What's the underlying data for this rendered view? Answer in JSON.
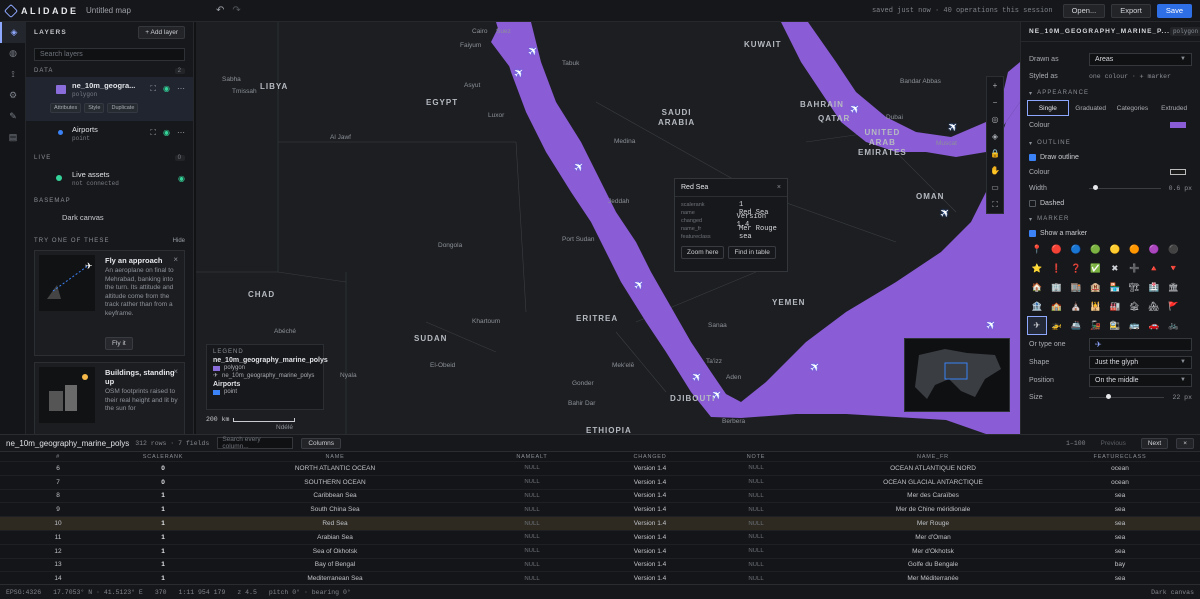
{
  "app": {
    "name": "ALIDADE",
    "map_title": "Untitled map",
    "status": "saved just now · 40 operations this session",
    "open_label": "Open...",
    "export_label": "Export",
    "save_label": "Save"
  },
  "layers_panel": {
    "title": "LAYERS",
    "add_label": "+ Add layer",
    "search_placeholder": "Search layers",
    "data_section": "DATA",
    "data_count": "2",
    "layers": [
      {
        "name": "ne_10m_geogra...",
        "type": "polygon",
        "chips": [
          "Attributes",
          "Style",
          "Duplicate"
        ]
      },
      {
        "name": "Airports",
        "type": "point"
      }
    ],
    "live_section": "LIVE",
    "live_count": "0",
    "live": {
      "name": "Live assets",
      "status": "not connected"
    },
    "basemap_section": "BASEMAP",
    "basemap": "Dark canvas",
    "try_title": "TRY ONE OF THESE",
    "hide_label": "Hide",
    "cards": [
      {
        "title": "Fly an approach",
        "text": "An aeroplane on final to Mehrabad, banking into the turn. Its attitude and altitude come from the track rather than from a keyframe.",
        "button": "Fly it"
      },
      {
        "title": "Buildings, standing up",
        "text": "OSM footprints raised to their real height and lit by the sun for",
        "button": ""
      }
    ]
  },
  "map": {
    "labels": {
      "libya": "LIBYA",
      "egypt": "EGYPT",
      "saudi": "SAUDI\nARABIA",
      "kuwait": "KUWAIT",
      "bahrain": "BAHRAIN",
      "qatar": "QATAR",
      "uae": "UNITED\nARAB\nEMIRATES",
      "oman": "OMAN",
      "chad": "CHAD",
      "sudan": "SUDAN",
      "eritrea": "ERITREA",
      "yemen": "YEMEN",
      "djibouti": "DJIBOUTI",
      "ethiopia": "ETHIOPIA",
      "faiyum": "Faiyum",
      "cairo": "Cairo",
      "suez": "Suez",
      "tabuk": "Tabuk",
      "sabha": "Sabha",
      "timissah": "Tmissah",
      "asyut": "Asyut",
      "luxor": "Luxor",
      "aljawf": "Al Jawf",
      "medina": "Medina",
      "jeddah": "Jeddah",
      "dongola": "Dongola",
      "portsudan": "Port Sudan",
      "khartoum": "Khartoum",
      "abeche": "Abéché",
      "elobeid": "El-Obeid",
      "nyala": "Nyala",
      "mekele": "Mek'elē",
      "gonder": "Gonder",
      "bahirdar": "Bahir Dar",
      "sanaa": "Sanaa",
      "taizz": "Ta'izz",
      "aden": "Aden",
      "berbera": "Berbera",
      "ndele": "Ndélé",
      "bandar": "Bandar Abbas",
      "muscat": "Muscat",
      "dubai": "Dubai"
    },
    "popup": {
      "title": "Red Sea",
      "close": "×",
      "fields": [
        {
          "k": "scalerank",
          "v": "1"
        },
        {
          "k": "name",
          "v": "Red Sea"
        },
        {
          "k": "changed",
          "v": "Version 1.4"
        },
        {
          "k": "name_fr",
          "v": "Mer Rouge"
        },
        {
          "k": "featureclass",
          "v": "sea"
        }
      ],
      "zoom_label": "Zoom here",
      "find_label": "Find in table"
    },
    "legend": {
      "title": "LEGEND",
      "layer1": "ne_10m_geography_marine_polys",
      "item1": "polygon",
      "item2": "ne_10m_geography_marine_polys",
      "layer2": "Airports",
      "item3": "point"
    },
    "scale": "200 km",
    "colors": {
      "sea": "#8a5cd6",
      "land": "#1f2124",
      "accent": "#8fa8ff"
    }
  },
  "inspector": {
    "title": "NE_10M_GEOGRAPHY_MARINE_P...",
    "type": "polygon",
    "drawn_as_label": "Drawn as",
    "drawn_as": "Areas",
    "styled_as_label": "Styled as",
    "styled_as": "one colour · ✈ marker",
    "appearance": "APPEARANCE",
    "tabs": [
      "Single",
      "Graduated",
      "Categories",
      "Extruded"
    ],
    "colour_label": "Colour",
    "outline": "OUTLINE",
    "draw_outline": "Draw outline",
    "outline_colour": "Colour",
    "width_label": "Width",
    "width_value": "0.6 px",
    "dashed": "Dashed",
    "marker": "MARKER",
    "show_marker": "Show a marker",
    "glyphs": [
      "📍",
      "🔴",
      "🔵",
      "🟢",
      "🟡",
      "🟠",
      "🟣",
      "⚫",
      "⭐",
      "❗",
      "❓",
      "✅",
      "✖",
      "➕",
      "🔺",
      "🔻",
      "🏠",
      "🏢",
      "🏬",
      "🏨",
      "🏪",
      "🏗",
      "🏥",
      "🏛",
      "🏦",
      "🏫",
      "⛪",
      "🕌",
      "🏭",
      "🏚",
      "🏘",
      "🚩",
      "✈",
      "🚁",
      "🚢",
      "🚂",
      "🚉",
      "🚌",
      "🚗",
      "🚲"
    ],
    "type_one_label": "Or type one",
    "type_one_value": "✈",
    "shape_label": "Shape",
    "shape_value": "Just the glyph",
    "position_label": "Position",
    "position_value": "On the middle",
    "size_label": "Size",
    "size_value": "22 px"
  },
  "table": {
    "name": "ne_10m_geography_marine_polys",
    "meta": "312 rows · 7 fields",
    "search_placeholder": "Search every column...",
    "columns_label": "Columns",
    "range": "1–100",
    "prev_label": "Previous",
    "next_label": "Next",
    "close": "×",
    "headers": [
      "#",
      "SCALERANK",
      "NAME",
      "NAMEALT",
      "CHANGED",
      "NOTE",
      "NAME_FR",
      "FEATURECLASS"
    ],
    "rows": [
      [
        "6",
        "0",
        "NORTH ATLANTIC OCEAN",
        "NULL",
        "Version 1.4",
        "NULL",
        "OCÉAN ATLANTIQUE NORD",
        "ocean"
      ],
      [
        "7",
        "0",
        "SOUTHERN OCEAN",
        "NULL",
        "Version 1.4",
        "NULL",
        "OCÉAN GLACIAL ANTARCTIQUE",
        "ocean"
      ],
      [
        "8",
        "1",
        "Caribbean Sea",
        "NULL",
        "Version 1.4",
        "NULL",
        "Mer des Caraïbes",
        "sea"
      ],
      [
        "9",
        "1",
        "South China Sea",
        "NULL",
        "Version 1.4",
        "NULL",
        "Mer de Chine méridionale",
        "sea"
      ],
      [
        "10",
        "1",
        "Red Sea",
        "NULL",
        "Version 1.4",
        "NULL",
        "Mer Rouge",
        "sea"
      ],
      [
        "11",
        "1",
        "Arabian Sea",
        "NULL",
        "Version 1.4",
        "NULL",
        "Mer d'Oman",
        "sea"
      ],
      [
        "12",
        "1",
        "Sea of Okhotsk",
        "NULL",
        "Version 1.4",
        "NULL",
        "Mer d'Okhotsk",
        "sea"
      ],
      [
        "13",
        "1",
        "Bay of Bengal",
        "NULL",
        "Version 1.4",
        "NULL",
        "Golfe du Bengale",
        "bay"
      ],
      [
        "14",
        "1",
        "Mediterranean Sea",
        "NULL",
        "Version 1.4",
        "NULL",
        "Mer Méditerranée",
        "sea"
      ]
    ],
    "selected_index": 4
  },
  "statusbar": {
    "crs": "EPSG:4326",
    "coords": "17.7053° N · 41.5123° E",
    "elev": "370",
    "scale": "1:11 954 179",
    "zoom": "z 4.5",
    "pitch": "pitch 0° · bearing 0°",
    "basemap": "Dark canvas"
  }
}
